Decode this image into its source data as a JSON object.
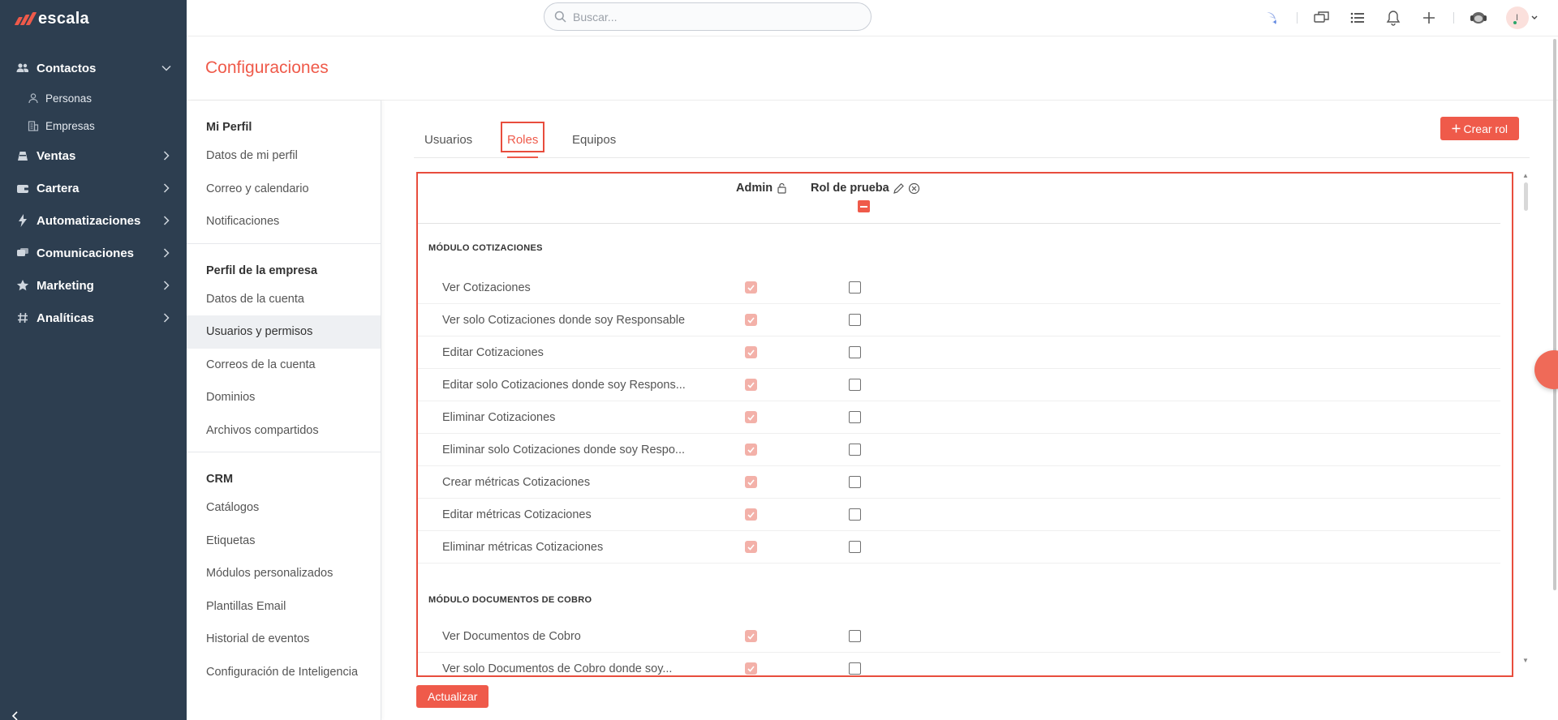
{
  "app": {
    "logo_text": "escala",
    "brand_color": "#ef5a4a",
    "sidebar_color": "#2d3e50"
  },
  "sidebar": {
    "items": [
      {
        "label": "Contactos",
        "icon": "people-icon",
        "expanded": true,
        "children": [
          {
            "label": "Personas",
            "icon": "person-icon"
          },
          {
            "label": "Empresas",
            "icon": "building-icon"
          }
        ]
      },
      {
        "label": "Ventas",
        "icon": "sales-icon"
      },
      {
        "label": "Cartera",
        "icon": "wallet-icon"
      },
      {
        "label": "Automatizaciones",
        "icon": "lightning-icon"
      },
      {
        "label": "Comunicaciones",
        "icon": "chat-icon"
      },
      {
        "label": "Marketing",
        "icon": "star-icon"
      },
      {
        "label": "Analíticas",
        "icon": "hash-icon"
      }
    ]
  },
  "topbar": {
    "search_placeholder": "Buscar...",
    "avatar_initial": "I"
  },
  "page": {
    "title": "Configuraciones"
  },
  "settings_menu": {
    "sections": [
      {
        "title": "Mi Perfil",
        "items": [
          "Datos de mi perfil",
          "Correo y calendario",
          "Notificaciones"
        ]
      },
      {
        "title": "Perfil de la empresa",
        "items": [
          "Datos de la cuenta",
          "Usuarios y permisos",
          "Correos de la cuenta",
          "Dominios",
          "Archivos compartidos"
        ]
      },
      {
        "title": "CRM",
        "items": [
          "Catálogos",
          "Etiquetas",
          "Módulos personalizados",
          "Plantillas Email",
          "Historial de eventos",
          "Configuración de Inteligencia"
        ]
      }
    ],
    "active_item": "Usuarios y permisos"
  },
  "tabs": {
    "users": "Usuarios",
    "roles": "Roles",
    "teams": "Equipos",
    "active": "Roles"
  },
  "create_button": "Crear rol",
  "roles_table": {
    "columns": {
      "admin": "Admin",
      "custom_role": "Rol de prueba"
    },
    "modules": [
      {
        "title": "MÓDULO COTIZACIONES",
        "permissions": [
          "Ver Cotizaciones",
          "Ver solo Cotizaciones donde soy Responsable",
          "Editar Cotizaciones",
          "Editar solo Cotizaciones donde soy Respons...",
          "Eliminar Cotizaciones",
          "Eliminar solo Cotizaciones donde soy Respo...",
          "Crear métricas Cotizaciones",
          "Editar métricas Cotizaciones",
          "Eliminar métricas Cotizaciones"
        ]
      },
      {
        "title": "MÓDULO DOCUMENTOS DE COBRO",
        "permissions": [
          "Ver Documentos de Cobro",
          "Ver solo Documentos de Cobro donde soy..."
        ]
      }
    ]
  },
  "update_button": "Actualizar"
}
